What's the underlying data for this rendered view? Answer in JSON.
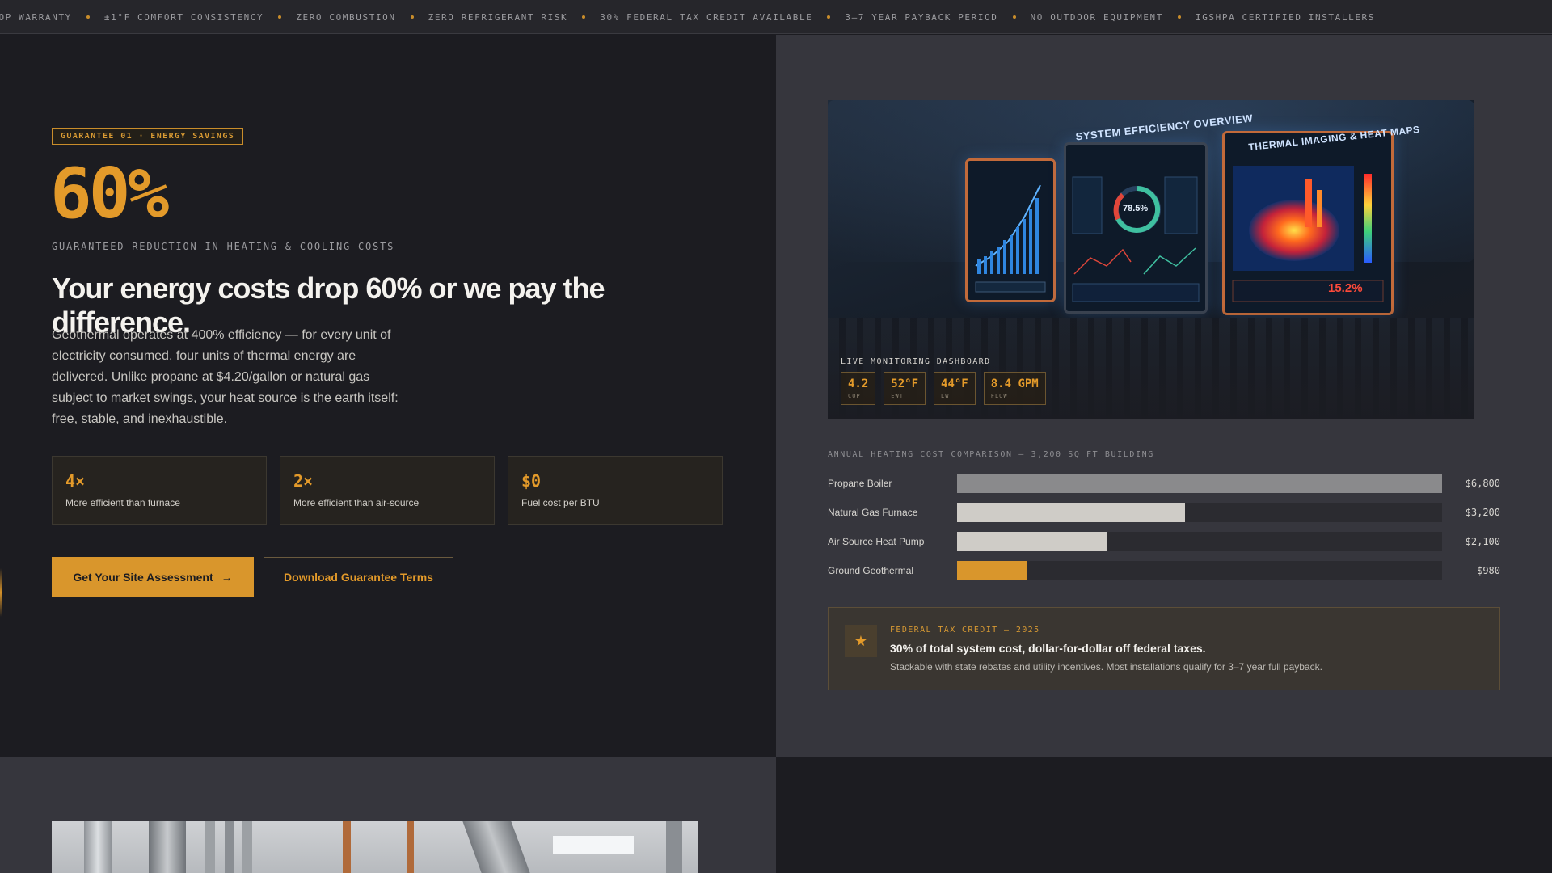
{
  "ticker": {
    "items": [
      "LOOP WARRANTY",
      "±1°F COMFORT CONSISTENCY",
      "ZERO COMBUSTION",
      "ZERO REFRIGERANT RISK",
      "30% FEDERAL TAX CREDIT AVAILABLE",
      "3–7 YEAR PAYBACK PERIOD",
      "NO OUTDOOR EQUIPMENT",
      "IGSHPA CERTIFIED INSTALLERS"
    ]
  },
  "hero": {
    "tag": "GUARANTEE 01 · ENERGY SAVINGS",
    "big_stat": "60%",
    "subline": "GUARANTEED REDUCTION IN HEATING & COOLING COSTS",
    "headline": "Your energy costs drop 60% or we pay the difference.",
    "body": "Geothermal operates at 400% efficiency — for every unit of electricity consumed, four units of thermal energy are delivered. Unlike propane at $4.20/gallon or natural gas subject to market swings, your heat source is the earth itself: free, stable, and inexhaustible.",
    "stats": [
      {
        "value": "4×",
        "label": "More efficient than furnace"
      },
      {
        "value": "2×",
        "label": "More efficient than air-source"
      },
      {
        "value": "$0",
        "label": "Fuel cost per BTU"
      }
    ],
    "cta_primary": "Get Your Site Assessment",
    "cta_primary_arrow": "→",
    "cta_secondary": "Download Guarantee Terms"
  },
  "dashboard": {
    "screen_titles": [
      "SYSTEM EFFICIENCY OVERVIEW",
      "THERMAL IMAGING & HEAT MAPS"
    ],
    "gauge_value": "78.5%",
    "thermal_loss": "15.2%",
    "label": "LIVE MONITORING DASHBOARD",
    "metrics": [
      {
        "value": "4.2",
        "label": "COP"
      },
      {
        "value": "52°F",
        "label": "EWT"
      },
      {
        "value": "44°F",
        "label": "LWT"
      },
      {
        "value": "8.4 GPM",
        "label": "FLOW"
      }
    ]
  },
  "comparison": {
    "title": "ANNUAL HEATING COST COMPARISON — 3,200 SQ FT BUILDING",
    "max": 6800,
    "rows": [
      {
        "label": "Propane Boiler",
        "value": 6800,
        "display": "$6,800",
        "color": "#8a8a8c"
      },
      {
        "label": "Natural Gas Furnace",
        "value": 3200,
        "display": "$3,200",
        "color": "#cfccc7"
      },
      {
        "label": "Air Source Heat Pump",
        "value": 2100,
        "display": "$2,100",
        "color": "#cfccc7"
      },
      {
        "label": "Ground Geothermal",
        "value": 980,
        "display": "$980",
        "color": "#d9962c"
      }
    ]
  },
  "tax_credit": {
    "kicker": "FEDERAL TAX CREDIT — 2025",
    "headline": "30% of total system cost, dollar-for-dollar off federal taxes.",
    "sub": "Stackable with state rebates and utility incentives. Most installations qualify for 3–7 year full payback.",
    "icon": "star-icon"
  },
  "colors": {
    "accent": "#d9962c",
    "bg_dark": "#1c1c21",
    "bg_panel": "#36363d"
  }
}
